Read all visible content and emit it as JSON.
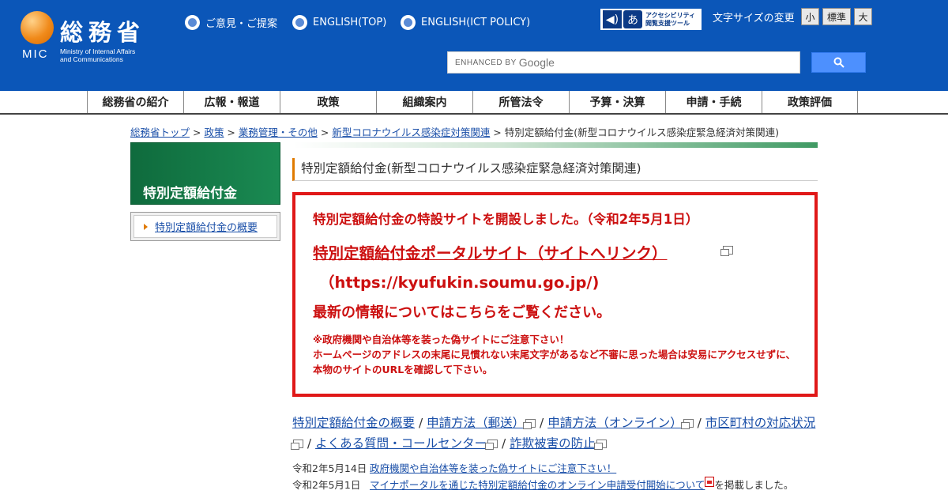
{
  "header": {
    "logo_ja": "総務省",
    "logo_abbr": "MIC",
    "logo_en": "Ministry of Internal Affairs\nand Communications",
    "toplinks": [
      "ご意見・ご提案",
      "ENGLISH(TOP)",
      "ENGLISH(ICT POLICY)"
    ],
    "a11y_label": "アクセシビリティ\n閲覧支援ツール",
    "a11y_char": "あ",
    "fontsize_label": "文字サイズの変更",
    "fontsize_options": [
      "小",
      "標準",
      "大"
    ],
    "search_enhanced": "ENHANCED BY",
    "search_google": "Google"
  },
  "gnav": [
    "総務省の紹介",
    "広報・報道",
    "政策",
    "組織案内",
    "所管法令",
    "予算・決算",
    "申請・手続",
    "政策評価"
  ],
  "breadcrumb": {
    "items": [
      "総務省トップ",
      "政策",
      "業務管理・その他",
      "新型コロナウイルス感染症対策関連"
    ],
    "separator": " > ",
    "current": "特別定額給付金(新型コロナウイルス感染症緊急経済対策関連)"
  },
  "sidebar": {
    "heading": "特別定額給付金",
    "item": "特別定額給付金の概要"
  },
  "main": {
    "title": "特別定額給付金(新型コロナウイルス感染症緊急経済対策関連)",
    "notice": {
      "line1": "特別定額給付金の特設サイトを開設しました。（令和2年5月1日）",
      "portal_link": "特別定額給付金ポータルサイト（サイトへリンク）",
      "url": "（https://kyufukin.soumu.go.jp/)",
      "line3": "最新の情報についてはこちらをご覧ください。",
      "warn1": "※政府機関や自治体等を装った偽サイトにご注意下さい！",
      "warn2": "ホームページのアドレスの末尾に見慣れない末尾文字があるなど不審に思った場合は安易にアクセスせずに、本物のサイトのURLを確認して下さい。"
    },
    "links": [
      "特別定額給付金の概要",
      "申請方法（郵送）",
      "申請方法（オンライン）",
      "市区町村の対応状況",
      "よくある質問・コールセンター",
      "詐欺被害の防止"
    ],
    "link_separator": " / ",
    "news": [
      {
        "date": "令和2年5月14日",
        "link": "政府機関や自治体等を装った偽サイトにご注意下さい！",
        "suffix": ""
      },
      {
        "date": "令和2年5月1日",
        "link": "マイナポータルを通じた特別定額給付金のオンライン申請受付開始について",
        "suffix": "を掲載しました。"
      }
    ]
  },
  "colors": {
    "header_bg": "#0b56b8",
    "notice_red": "#e01818",
    "sidebar_green": "#0f6b3d",
    "link_blue": "#1a4fa8"
  }
}
